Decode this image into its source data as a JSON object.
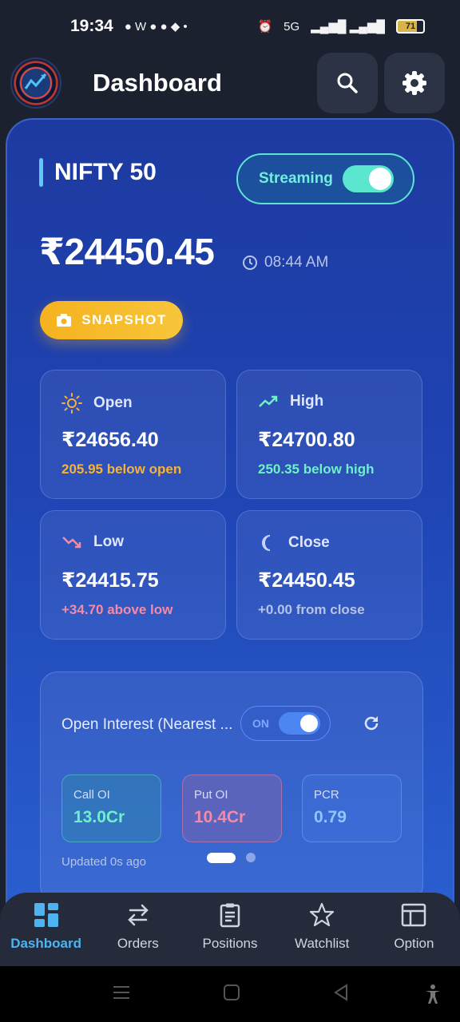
{
  "status_bar": {
    "time": "19:34",
    "battery": "71",
    "network": "5G"
  },
  "header": {
    "title": "Dashboard"
  },
  "index": {
    "name": "NIFTY 50",
    "streaming_label": "Streaming",
    "streaming_on": true,
    "price": "₹24450.45",
    "time": "08:44 AM",
    "snapshot_label": "SNAPSHOT"
  },
  "stats": {
    "open": {
      "label": "Open",
      "value": "₹24656.40",
      "sub": "205.95 below open",
      "sub_color": "#f6b23a"
    },
    "high": {
      "label": "High",
      "value": "₹24700.80",
      "sub": "250.35 below high",
      "sub_color": "#6ff0c8"
    },
    "low": {
      "label": "Low",
      "value": "₹24415.75",
      "sub": "+34.70 above low",
      "sub_color": "#f58aa6"
    },
    "close": {
      "label": "Close",
      "value": "₹24450.45",
      "sub": "+0.00 from close",
      "sub_color": "#b6c4ea"
    }
  },
  "open_interest": {
    "title": "Open Interest (Nearest ...",
    "toggle_label": "ON",
    "call_label": "Call OI",
    "call_value": "13.0Cr",
    "put_label": "Put OI",
    "put_value": "10.4Cr",
    "pcr_label": "PCR",
    "pcr_value": "0.79",
    "updated": "Updated 0s ago"
  },
  "bottom_nav": {
    "items": [
      {
        "label": "Dashboard",
        "icon": "grid-icon"
      },
      {
        "label": "Orders",
        "icon": "swap-icon"
      },
      {
        "label": "Positions",
        "icon": "clipboard-icon"
      },
      {
        "label": "Watchlist",
        "icon": "star-icon"
      },
      {
        "label": "Option",
        "icon": "table-icon"
      }
    ]
  },
  "colors": {
    "accent": "#4fb3f0",
    "streaming": "#5ae6cf",
    "snapshot": "#f6b21f",
    "card_bg": "#1f44b4"
  }
}
